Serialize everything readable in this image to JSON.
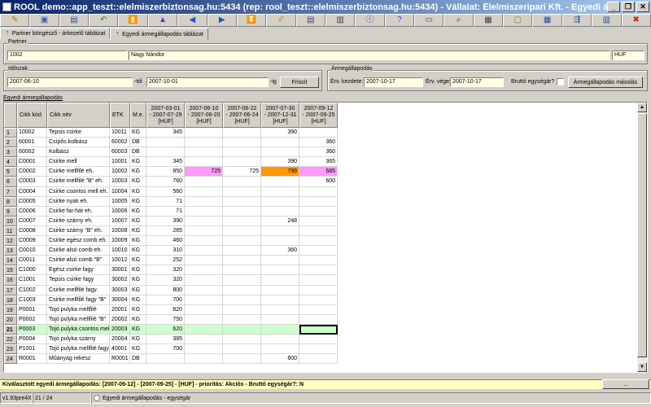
{
  "window": {
    "title": "ROOL demo::app_teszt::elelmiszerbiztonsag.hu:5434 (rep: rool_teszt::elelmiszerbiztonsag.hu:5434) - Vállalat: Élelmiszeripari Kft. - Egyedi árm...",
    "min": "_",
    "max": "❐",
    "close": "✕"
  },
  "toolbar": [
    {
      "name": "pencil-icon",
      "glyph": "✎",
      "color": "#c07000"
    },
    {
      "name": "open-icon",
      "glyph": "▣",
      "color": "#3060c0"
    },
    {
      "name": "save-icon",
      "glyph": "▤",
      "color": "#3050a0"
    },
    {
      "name": "undo-icon",
      "glyph": "↶",
      "color": "#208020"
    },
    {
      "name": "first-record-icon",
      "glyph": "⏫",
      "color": "#2050d0"
    },
    {
      "name": "previous-record-icon",
      "glyph": "▲",
      "color": "#2050d0"
    },
    {
      "name": "back-icon",
      "glyph": "◀",
      "color": "#2050d0"
    },
    {
      "name": "forward-icon",
      "glyph": "▶",
      "color": "#2050d0"
    },
    {
      "name": "last-record-icon",
      "glyph": "⏬",
      "color": "#2050d0"
    },
    {
      "name": "edit-note-icon",
      "glyph": "✐",
      "color": "#c09020"
    },
    {
      "name": "document-icon",
      "glyph": "▤",
      "color": "#404080"
    },
    {
      "name": "print-icon",
      "glyph": "▥",
      "color": "#404040"
    },
    {
      "name": "info-icon",
      "glyph": "ⓘ",
      "color": "#2050d0"
    },
    {
      "name": "help-icon",
      "glyph": "?",
      "color": "#2050d0"
    },
    {
      "name": "window-icon",
      "glyph": "▭",
      "color": "#404080"
    },
    {
      "name": "search-icon",
      "glyph": "⌕",
      "color": "#404040"
    },
    {
      "name": "table-icon",
      "glyph": "▦",
      "color": "#404040"
    },
    {
      "name": "note-icon",
      "glyph": "▢",
      "color": "#808020"
    },
    {
      "name": "grid-icon",
      "glyph": "▦",
      "color": "#2050a0"
    },
    {
      "name": "export-icon",
      "glyph": "⇶",
      "color": "#2050a0"
    },
    {
      "name": "columns-icon",
      "glyph": "▥",
      "color": "#2050a0"
    },
    {
      "name": "stop-icon",
      "glyph": "✖",
      "color": "#d02020"
    }
  ],
  "tabs": {
    "browser": "Partner böngésző - árkezelő táblázat",
    "detail": "Egyedi ármegállapodás táblázat"
  },
  "partner": {
    "label": "Partner",
    "code": "1002",
    "name": "Nagy Nándor",
    "currency": "HUF"
  },
  "period": {
    "label": "Időszak",
    "from": "2007-06-10",
    "to_label": "-tól",
    "to": "2007-10-01",
    "until_label": "-ig",
    "refresh": "Frissít"
  },
  "agreement": {
    "label": "Ármegállapodás",
    "start_label": "Érv. kezdete:",
    "start": "2007-10-17",
    "end_label": "Érv. vége:",
    "end": "2007-10-17",
    "gross_label": "Bruttó egységár?",
    "copy_button": "Ármegállapodás másolás"
  },
  "section_label": "Egyedi ármegállapodás",
  "grid": {
    "headers": [
      "Cikk kód",
      "Cikk név",
      "ETK",
      "M.e."
    ],
    "date_cols": [
      [
        "2007-03-01",
        "- 2007-07-29",
        "[HUF]"
      ],
      [
        "2007-06-10",
        "- 2007-06-20",
        "[HUF]"
      ],
      [
        "2007-06-22",
        "- 2007-06-24",
        "[HUF]"
      ],
      [
        "2007-07-30",
        "- 2007-12-31",
        "[HUF]"
      ],
      [
        "2007-09-12",
        "- 2007-09-25",
        "[HUF]"
      ]
    ],
    "rows": [
      [
        "1",
        "10002",
        "Tepsis csirke",
        "10011",
        "KG",
        "345",
        "",
        "",
        "390",
        ""
      ],
      [
        "2",
        "60001",
        "Csípős kolbász",
        "60002",
        "DB",
        "",
        "",
        "",
        "",
        "360"
      ],
      [
        "3",
        "60002",
        "Kolbász",
        "60003",
        "DB",
        "",
        "",
        "",
        "",
        "360"
      ],
      [
        "4",
        "C0001",
        "Csirke mell",
        "10001",
        "KG",
        "345",
        "",
        "",
        "390",
        "365"
      ],
      [
        "5",
        "C0002",
        "Csirke mellfilé eh.",
        "10002",
        "KG",
        "850",
        "725",
        "725",
        "799",
        "685"
      ],
      [
        "6",
        "C0003",
        "Csirke mellfilé \"B\" eh.",
        "10003",
        "KG",
        "760",
        "",
        "",
        "",
        "600"
      ],
      [
        "7",
        "C0004",
        "Csirke csontos mell eh.",
        "10004",
        "KG",
        "560",
        "",
        "",
        "",
        ""
      ],
      [
        "8",
        "C0005",
        "Csirke nyak eh.",
        "10005",
        "KG",
        "71",
        "",
        "",
        "",
        ""
      ],
      [
        "9",
        "C0006",
        "Csirke far-hát eh.",
        "10006",
        "KG",
        "71",
        "",
        "",
        "",
        ""
      ],
      [
        "10",
        "C0007",
        "Csirke szárny eh.",
        "10007",
        "KG",
        "390",
        "",
        "",
        "248",
        ""
      ],
      [
        "11",
        "C0008",
        "Csirke szárny \"B\" eh.",
        "10008",
        "KG",
        "285",
        "",
        "",
        "",
        ""
      ],
      [
        "12",
        "C0009",
        "Csirke egész comb eh.",
        "10009",
        "KG",
        "460",
        "",
        "",
        "",
        ""
      ],
      [
        "13",
        "C0010",
        "Csirke alsó comb eh.",
        "10010",
        "KG",
        "310",
        "",
        "",
        "360",
        ""
      ],
      [
        "14",
        "C0011",
        "Csirke alsó comb \"B\"",
        "10012",
        "KG",
        "252",
        "",
        "",
        "",
        ""
      ],
      [
        "15",
        "C1000",
        "Egész csirke fagy",
        "30001",
        "KG",
        "320",
        "",
        "",
        "",
        ""
      ],
      [
        "16",
        "C1001",
        "Tepsis csirke fagy",
        "30002",
        "KG",
        "320",
        "",
        "",
        "",
        ""
      ],
      [
        "17",
        "C1002",
        "Csirke mellfilé fagy.",
        "30003",
        "KG",
        "800",
        "",
        "",
        "",
        ""
      ],
      [
        "18",
        "C1003",
        "Csirke mellfilé fagy \"B\"",
        "30004",
        "KG",
        "700",
        "",
        "",
        "",
        ""
      ],
      [
        "19",
        "P0001",
        "Tojó pulyka mellfilé",
        "20001",
        "KG",
        "820",
        "",
        "",
        "",
        ""
      ],
      [
        "20",
        "P0002",
        "Tojó pulyka mellfilé \"B\"",
        "20002",
        "KG",
        "750",
        "",
        "",
        "",
        ""
      ],
      [
        "21",
        "P0003",
        "Tojó pulyka csontos mell",
        "20003",
        "KG",
        "620",
        "",
        "",
        "",
        ""
      ],
      [
        "22",
        "P0004",
        "Tojó pulyka szárny",
        "20004",
        "KG",
        "385",
        "",
        "",
        "",
        ""
      ],
      [
        "23",
        "P1001",
        "Tojó pulyka mellfilé fagy",
        "40001",
        "KG",
        "700",
        "",
        "",
        "",
        ""
      ],
      [
        "24",
        "R0001",
        "Műanyag rekesz",
        "R0001",
        "DB",
        "",
        "",
        "",
        "600",
        ""
      ]
    ]
  },
  "info": {
    "text": "Kiválasztott egyedi ármegállapodás: [2007-09-12] - [2007-09-25] - [HUF] - prioritás: Akciós - Bruttó egységár?: N",
    "button": "..."
  },
  "status": {
    "version": "v1.93pre4X",
    "position": "21 / 24",
    "mode": "Egyedi ármegállapodás - egységár"
  }
}
